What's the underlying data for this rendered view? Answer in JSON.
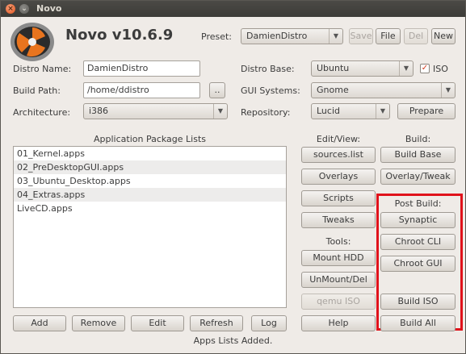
{
  "window": {
    "title": "Novo"
  },
  "app": {
    "title": "Novo v10.6.9"
  },
  "preset": {
    "label": "Preset:",
    "value": "DamienDistro",
    "save": "Save",
    "file": "File",
    "del": "Del",
    "new": "New"
  },
  "form": {
    "distro_name_label": "Distro Name:",
    "distro_name_value": "DamienDistro",
    "build_path_label": "Build Path:",
    "build_path_value": "/home/ddistro",
    "browse": "..",
    "architecture_label": "Architecture:",
    "architecture_value": "i386",
    "distro_base_label": "Distro Base:",
    "distro_base_value": "Ubuntu",
    "iso_label": "ISO",
    "iso_checked": "✓",
    "gui_label": "GUI Systems:",
    "gui_value": "Gnome",
    "repo_label": "Repository:",
    "repo_value": "Lucid",
    "prepare": "Prepare"
  },
  "packages": {
    "heading": "Application Package Lists",
    "items": [
      "01_Kernel.apps",
      "02_PreDesktopGUI.apps",
      "03_Ubuntu_Desktop.apps",
      "04_Extras.apps",
      "LiveCD.apps"
    ]
  },
  "edit_view": {
    "heading": "Edit/View:",
    "sources": "sources.list",
    "overlays": "Overlays",
    "scripts": "Scripts",
    "tweaks": "Tweaks"
  },
  "tools": {
    "heading": "Tools:",
    "mount": "Mount HDD",
    "unmount": "UnMount/Del",
    "qemu": "qemu ISO"
  },
  "build": {
    "heading": "Build:",
    "build_base": "Build Base",
    "overlay_tweak": "Overlay/Tweak",
    "build_iso": "Build ISO",
    "build_all": "Build All"
  },
  "post_build": {
    "heading": "Post Build:",
    "synaptic": "Synaptic",
    "chroot_cli": "Chroot CLI",
    "chroot_gui": "Chroot GUI"
  },
  "bottom": {
    "add": "Add",
    "remove": "Remove",
    "edit": "Edit",
    "refresh": "Refresh",
    "log": "Log",
    "help": "Help"
  },
  "status": "Apps Lists Added.",
  "colors": {
    "highlight": "#e0121b",
    "window_bg": "#efebe7",
    "titlebar": "#3c3b37"
  }
}
